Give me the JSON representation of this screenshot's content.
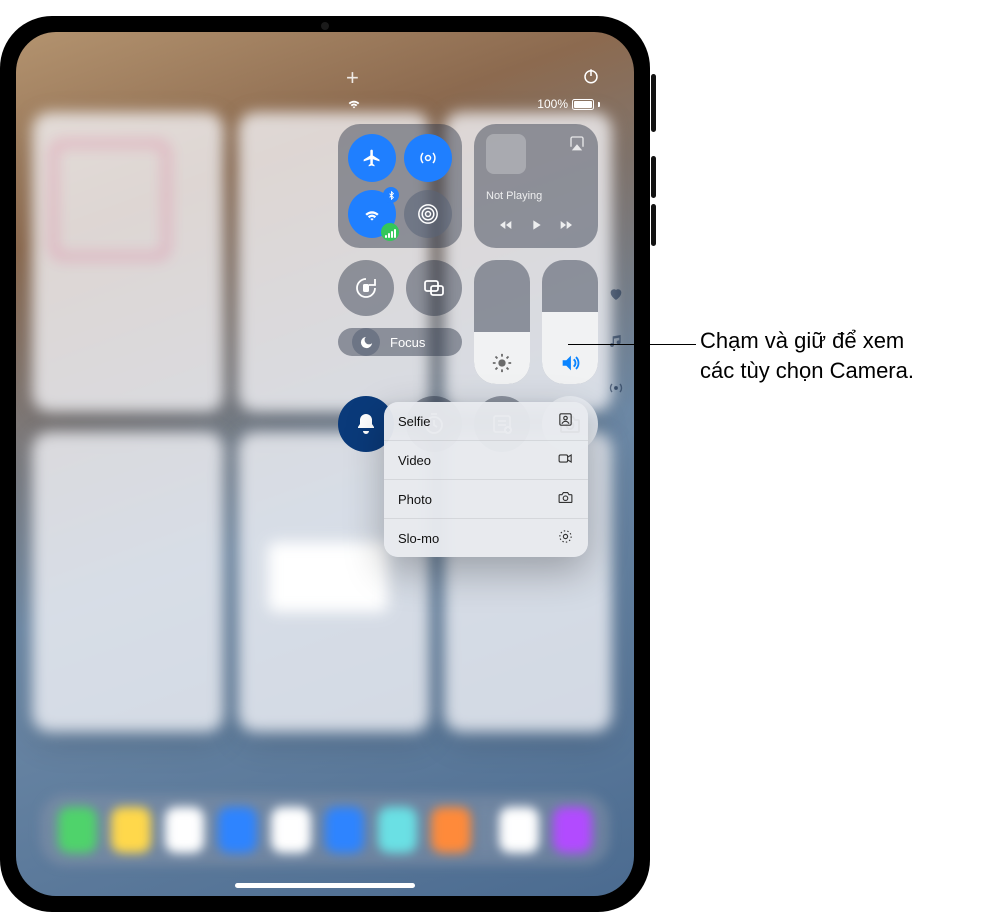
{
  "status": {
    "battery_text": "100%"
  },
  "control_center": {
    "media": {
      "not_playing": "Not Playing"
    },
    "focus_label": "Focus"
  },
  "camera_menu": {
    "items": [
      {
        "label": "Selfie"
      },
      {
        "label": "Video"
      },
      {
        "label": "Photo"
      },
      {
        "label": "Slo-mo"
      }
    ]
  },
  "callout": {
    "line1": "Chạm và giữ để xem",
    "line2": "các tùy chọn Camera."
  }
}
